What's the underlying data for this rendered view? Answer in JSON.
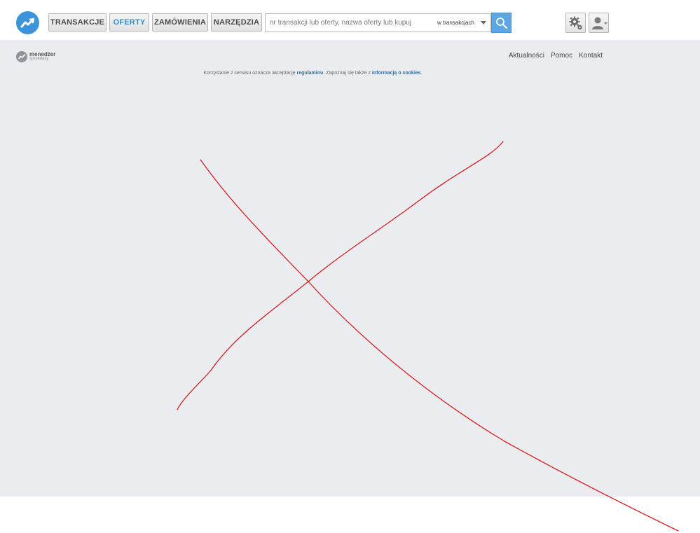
{
  "nav": {
    "items": [
      {
        "label": "TRANSAKCJE",
        "active": false
      },
      {
        "label": "OFERTY",
        "active": true
      },
      {
        "label": "ZAMÓWIENIA",
        "active": false
      },
      {
        "label": "NARZĘDZIA",
        "active": false
      }
    ]
  },
  "search": {
    "placeholder": "nr transakcji lub oferty, nazwa oferty lub kupującego",
    "scope": "w transakcjach"
  },
  "brand": {
    "title": "menedżer",
    "subtitle": "sprzedaży"
  },
  "toplinks": [
    "Aktualności",
    "Pomoc",
    "Kontakt"
  ],
  "footer": {
    "text_before": "Korzystanie z serwisu oznacza akceptację ",
    "link1": "regulaminu",
    "text_middle": ". Zapoznaj się także z ",
    "link2": "informacją o cookies",
    "text_after": "."
  },
  "colors": {
    "accent": "#3d93d9",
    "active_tab": "#2f8fc9",
    "content_bg": "#eaecf0",
    "annotation": "#d42020"
  },
  "icons": {
    "logo": "trend-chart-icon",
    "search": "magnifier-icon",
    "settings": "gears-icon",
    "account": "user-icon"
  }
}
